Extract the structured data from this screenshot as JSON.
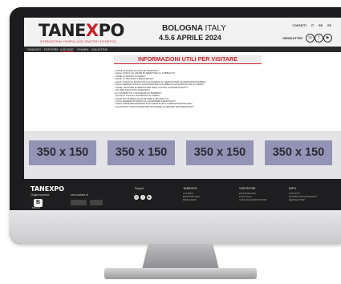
{
  "header": {
    "logo_text_part1": "TANE",
    "logo_accent": "X",
    "logo_text_part2": "PO",
    "logo_sub": "INTERNATIONAL FUNERAL AND CEMETERY EXHIBITION",
    "city_bold": "BOLOGNA",
    "city_light": "ITALY",
    "dates": "4.5.6 APRILE 2024",
    "contacts": "CONTATTI",
    "lang_it": "IT",
    "lang_en": "EN",
    "lang_es": "ES",
    "newsletter": "NEWSLETTER"
  },
  "nav": {
    "items": [
      "TANEXPO",
      "ESPORRE",
      "VISITARE",
      "STAMPA",
      "INDUSTRIE"
    ]
  },
  "content": {
    "title": "INFORMAZIONI UTILI PER VISITARE",
    "questions": [
      "COS'È QUANDE SI SVOLGE TANEXPO?",
      "QUALI SONO GLI ORARI DI APERTURA AL PUBBLICO?",
      "COME SI ARRIVA IN FIERA?",
      "DOVE SI TROVANO I PARCHEGGI?",
      "QUALI SONO LE MODALITÀ DI ACCESSO E I SERVIZI PER LE PERSONE DISABILI?",
      "QUALI SERVIZI SONO A DISPOSIZIONE DI PUBBLICO ED ESPOSITORI IN FIERA?",
      "COME TROVARE E PRENOTARE NEGLI HOTEL CONVENZIONATI?",
      "C'È WIFI GRATUITO TANEXPO?",
      "È CONSENTITO L'INGRESSO AI BAMBINI?",
      "QUANTO COSTA L'INGRESSO IN FIERA?",
      "DOVE È POSSIBILE ACQUISTARE IL BIGLIETTO?",
      "COSA VEDERE INTORNO AL QUARTIERE FIERISTICO?",
      "SONO AMMESSE RIPRESE FOTOGRAFICHE E CINEMATOGRAFICHE?",
      "CHI POSSO CONTATTARE PER RICEVERE ULTERIORI INFORMAZIONI?"
    ]
  },
  "banners": [
    "350 x 150",
    "350 x 150",
    "350 x 150",
    "350 x 150"
  ],
  "footer": {
    "logo": "TANEXPO",
    "organizzazione": "Organizzazione",
    "una_societa_di": "Una società di",
    "seguici": "Seguici",
    "col1_title": "TANEXPO",
    "col1_links": [
      "LA FIERA",
      "EDIZIONE 2024",
      "BROCHURE"
    ],
    "col2_title": "VISITATORI",
    "col2_links": [
      "EDIZIONE 2024",
      "FOTO GALL",
      "CATALOGO ESPOSITORI"
    ],
    "col3_title": "INFO",
    "col3_links": [
      "CONTATTI",
      "RICHIEDI INFORMAZIONI",
      "NEWSLETTER"
    ],
    "b_logo_letter": "B",
    "b_logo_caption": "BIFOOD"
  },
  "colors": {
    "accent": "#c8242b",
    "banner": "#9393b6",
    "footer_bg": "#1e1e20"
  }
}
